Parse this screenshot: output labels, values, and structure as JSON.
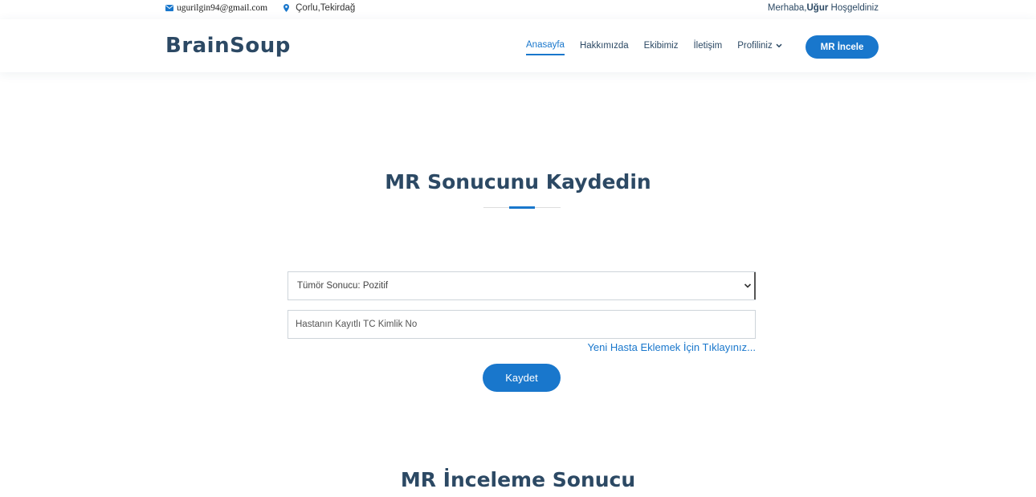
{
  "topbar": {
    "email": "ugurilgin94@gmail.com",
    "email_icon": "envelope-icon",
    "location": "Çorlu,Tekirdağ",
    "location_icon": "map-pin-icon",
    "greeting_prefix": "Merhaba,",
    "user_name": "Uğur",
    "greeting_suffix": " Hoşgeldiniz"
  },
  "header": {
    "logo": "BrainSoup",
    "nav": [
      {
        "label": "Anasayfa",
        "active": true
      },
      {
        "label": "Hakkımızda"
      },
      {
        "label": "Ekibimiz"
      },
      {
        "label": "İletişim"
      },
      {
        "label": "Profiliniz"
      }
    ],
    "cta_label": "MR İncele"
  },
  "section": {
    "title": "MR Sonucunu Kaydedin",
    "tumor_select_value": "Tümör Sonucu: Pozitif",
    "tc_placeholder": "Hastanın Kayıtlı TC Kimlik No",
    "new_patient_link": "Yeni Hasta Eklemek İçin Tıklayınız...",
    "save_label": "Kaydet"
  },
  "section2": {
    "title": "MR İnceleme Sonucu"
  },
  "colors": {
    "accent": "#1977cc",
    "text": "#2c4964"
  }
}
